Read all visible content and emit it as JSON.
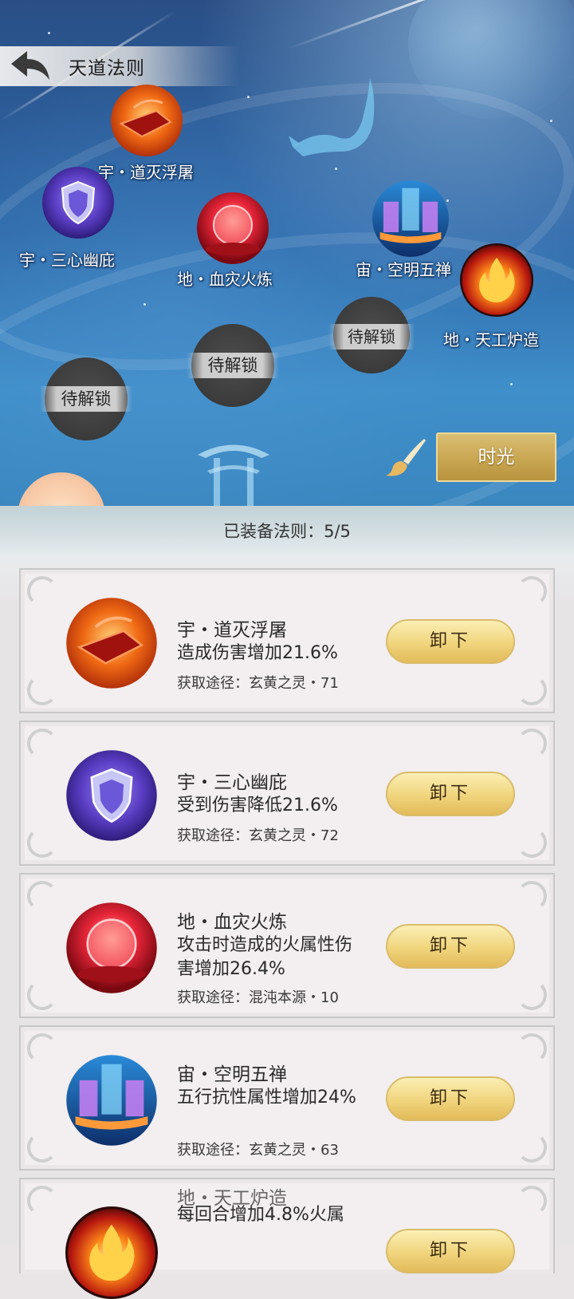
{
  "header": {
    "title": "天道法则",
    "back_icon": "back-arrow-icon"
  },
  "map": {
    "nodes": [
      {
        "label": "宇・道灭浮屠",
        "icon": "red-crystal-icon"
      },
      {
        "label": "宇・三心幽庇",
        "icon": "purple-shield-icon"
      },
      {
        "label": "地・血灾火炼",
        "icon": "red-orb-icon"
      },
      {
        "label": "宙・空明五禅",
        "icon": "crystal-gate-icon"
      },
      {
        "label": "地・天工炉造",
        "icon": "flame-icon"
      }
    ],
    "locked_label": "待解锁",
    "time_button": "时光",
    "brush_icon": "brush-icon"
  },
  "panel": {
    "equipped_prefix": "已装备法则：",
    "equipped_count": "5/5",
    "unequip_label": "卸下",
    "cards": [
      {
        "name": "宇・道灭浮屠",
        "effect": "造成伤害增加21.6%",
        "source": "获取途径：玄黄之灵・71",
        "icon": "red-crystal-icon"
      },
      {
        "name": "宇・三心幽庇",
        "effect": "受到伤害降低21.6%",
        "source": "获取途径：玄黄之灵・72",
        "icon": "purple-shield-icon"
      },
      {
        "name": "地・血灾火炼",
        "effect": "攻击时造成的火属性伤害增加26.4%",
        "source": "获取途径：混沌本源・10",
        "icon": "red-orb-icon"
      },
      {
        "name": "宙・空明五禅",
        "effect": "五行抗性属性增加24%",
        "source": "获取途径：玄黄之灵・63",
        "icon": "crystal-gate-icon"
      },
      {
        "name": "地・天工炉造",
        "effect": "每回合增加4.8%火属",
        "source": "",
        "icon": "flame-icon"
      }
    ]
  },
  "colors": {
    "gold_button": "#e2bb5a",
    "time_button": "#c9a652",
    "sky": "#2d67a8"
  }
}
